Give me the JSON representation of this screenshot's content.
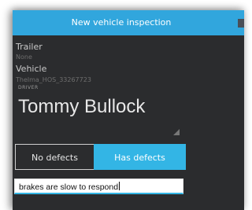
{
  "window": {
    "title": "New vehicle inspection",
    "accent_color": "#33b5e5"
  },
  "trailer": {
    "label": "Trailer",
    "value": "None"
  },
  "vehicle": {
    "label": "Vehicle",
    "value": "Thelma_HOS_33267723"
  },
  "driver": {
    "caption": "DRIVER",
    "name": "Tommy Bullock"
  },
  "defects_toggle": {
    "options": [
      "No defects",
      "Has defects"
    ],
    "selected": "Has defects"
  },
  "defect_input": {
    "value": "brakes are slow to respond"
  }
}
